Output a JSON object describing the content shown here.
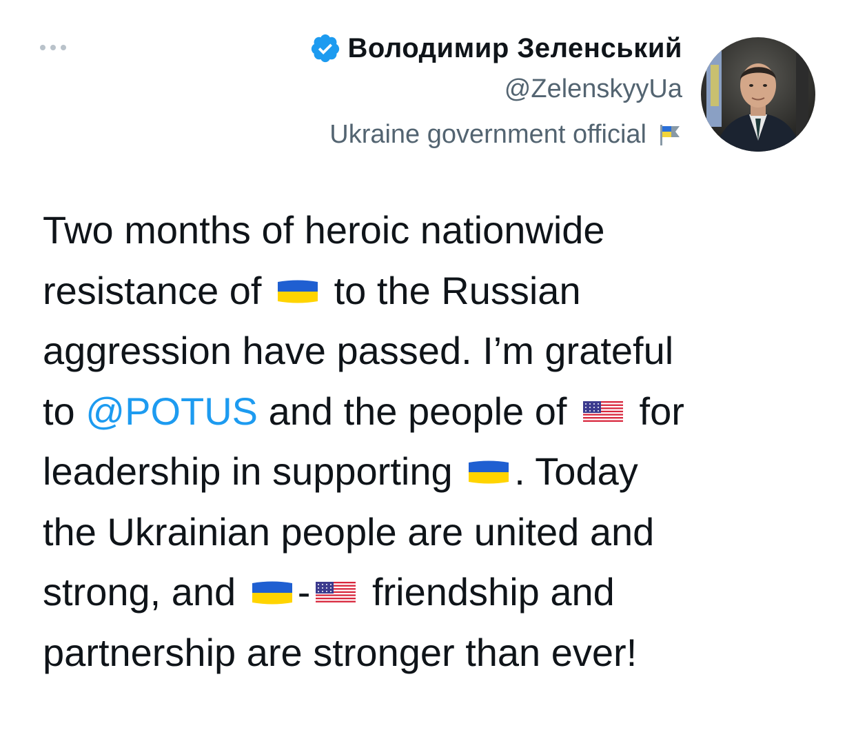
{
  "header": {
    "display_name": "Володимир Зеленський",
    "handle": "@ZelenskyyUa",
    "account_label": "Ukraine government official",
    "verified_icon": "verified-badge-icon",
    "label_icon": "flag-icon",
    "more_icon": "more-dots-icon"
  },
  "tweet": {
    "lines": [
      [
        {
          "t": "text",
          "v": "Two months of heroic nationwide"
        }
      ],
      [
        {
          "t": "text",
          "v": "resistance of "
        },
        {
          "t": "flag",
          "v": "ua"
        },
        {
          "t": "text",
          "v": " to the Russian"
        }
      ],
      [
        {
          "t": "text",
          "v": "aggression have passed. I’m grateful"
        }
      ],
      [
        {
          "t": "text",
          "v": "to "
        },
        {
          "t": "mention",
          "v": "@POTUS"
        },
        {
          "t": "text",
          "v": " and the people of "
        },
        {
          "t": "flag",
          "v": "us"
        },
        {
          "t": "text",
          "v": " for"
        }
      ],
      [
        {
          "t": "text",
          "v": "leadership in supporting "
        },
        {
          "t": "flag",
          "v": "ua"
        },
        {
          "t": "text",
          "v": ". Today"
        }
      ],
      [
        {
          "t": "text",
          "v": "the Ukrainian people are united and"
        }
      ],
      [
        {
          "t": "text",
          "v": "strong, and "
        },
        {
          "t": "flag",
          "v": "ua"
        },
        {
          "t": "text",
          "v": "-"
        },
        {
          "t": "flag",
          "v": "us"
        },
        {
          "t": "text",
          "v": " friendship and"
        }
      ],
      [
        {
          "t": "text",
          "v": "partnership are stronger than ever!"
        }
      ]
    ]
  },
  "colors": {
    "link": "#1d9bf0",
    "secondary_text": "#536471",
    "primary_text": "#0f1419",
    "verified": "#1d9bf0",
    "ua_blue": "#1f5fd1",
    "ua_yellow": "#ffd400",
    "us_red": "#d8263c",
    "us_blue": "#3c3b8e"
  }
}
